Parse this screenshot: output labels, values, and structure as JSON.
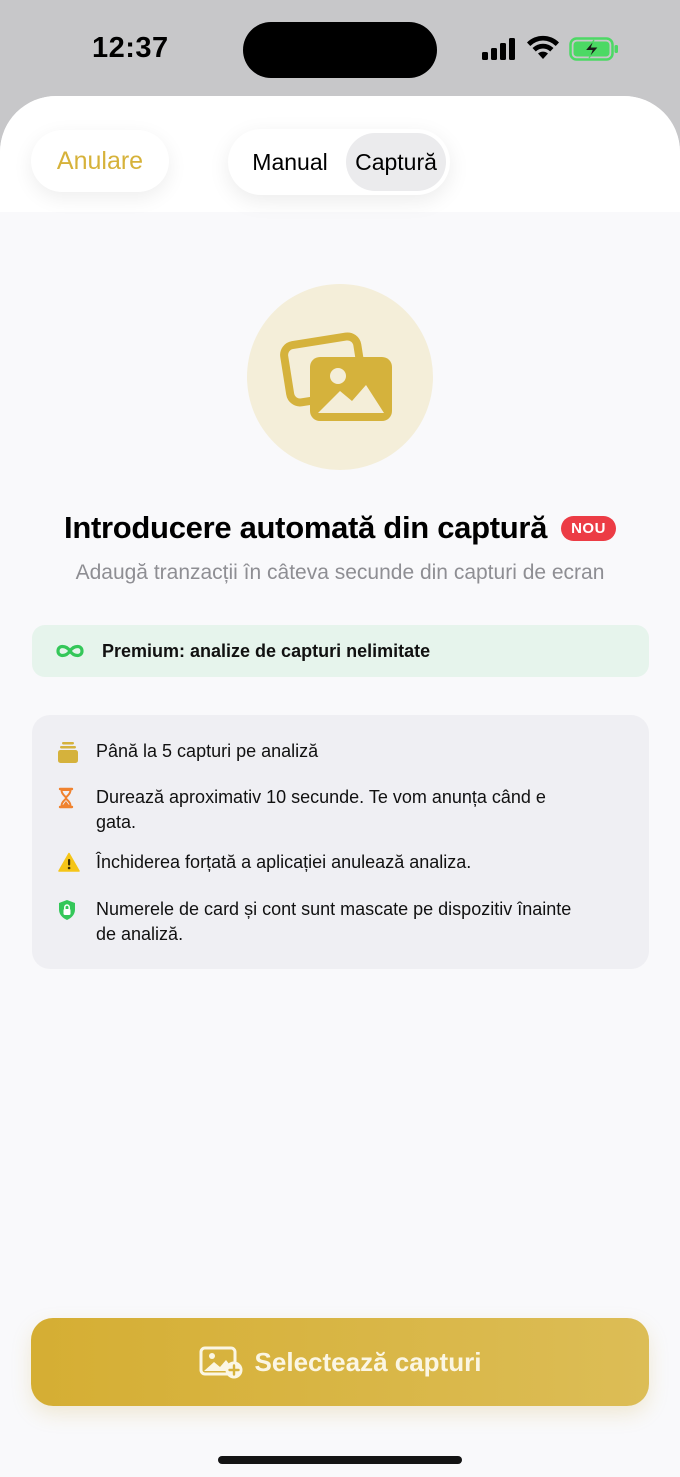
{
  "status_bar": {
    "time": "12:37"
  },
  "header": {
    "cancel_label": "Anulare",
    "segments": [
      "Manual",
      "Captură"
    ],
    "selected_segment": "Captură"
  },
  "hero": {
    "title": "Introducere automată din captură",
    "badge": "NOU",
    "subtitle": "Adaugă tranzacții în câteva secunde din capturi de ecran"
  },
  "premium": {
    "text": "Premium: analize de capturi nelimitate"
  },
  "info": {
    "items": [
      {
        "icon": "stack-icon",
        "text": "Până la 5 capturi pe analiză"
      },
      {
        "icon": "hourglass-icon",
        "text": "Durează aproximativ 10 secunde. Te vom anunța când e gata."
      },
      {
        "icon": "warning-icon",
        "text": "Închiderea forțată a aplicației anulează analiza."
      },
      {
        "icon": "shield-lock-icon",
        "text": "Numerele de card și cont sunt mascate pe dispozitiv înainte de analiză."
      }
    ]
  },
  "cta": {
    "label": "Selectează capturi"
  },
  "colors": {
    "accent": "#d6b23a",
    "badge": "#ec3c45",
    "premium_bg": "#e6f4ec",
    "infinity": "#34c759"
  }
}
